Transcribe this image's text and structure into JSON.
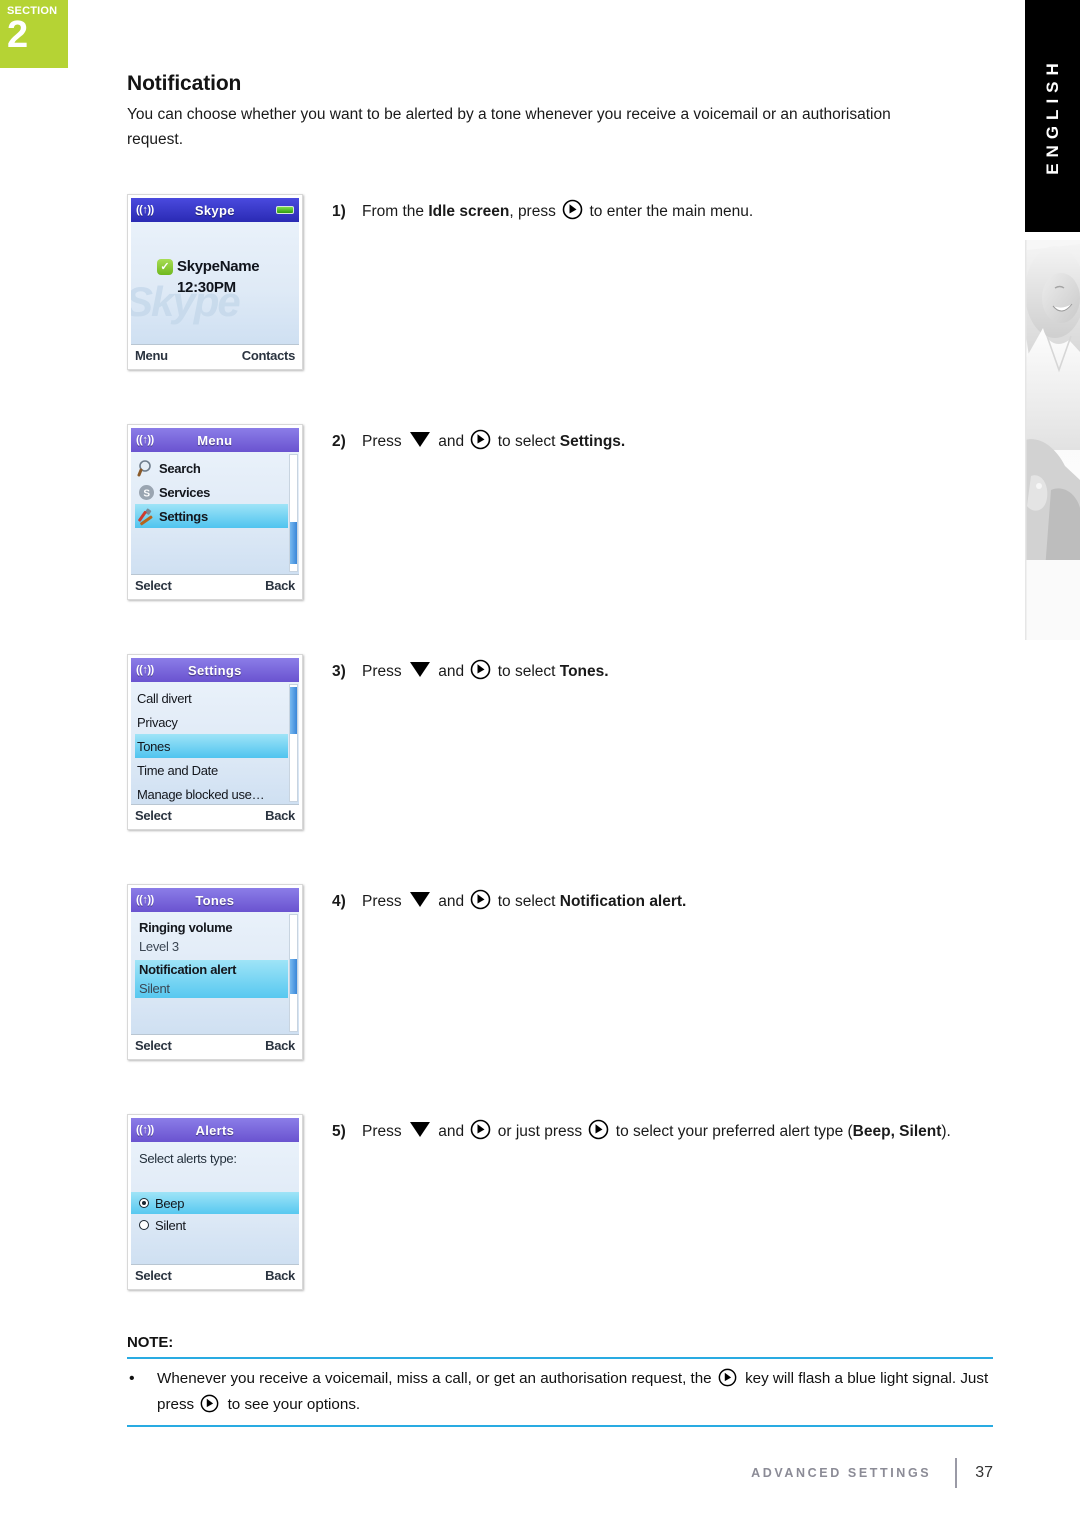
{
  "section_tab": {
    "label": "SECTION",
    "number": "2"
  },
  "language_tab": {
    "label": "ENGLISH"
  },
  "page": {
    "title": "Notification",
    "intro": "You can choose whether you want to be alerted by a tone whenever you receive a voicemail or an authorisation request."
  },
  "steps": [
    {
      "number": "1)",
      "text_parts": {
        "a": "From the ",
        "b": "Idle screen",
        "c": ", press ",
        "d": " to enter the main menu."
      },
      "screen": {
        "type": "idle",
        "title": "Skype",
        "signal_icon": "signal-icon",
        "battery_icon": "battery-icon",
        "status_icon": "online-check-icon",
        "username": "SkypeName",
        "time": "12:30PM",
        "watermark": "Skype",
        "softkey_left": "Menu",
        "softkey_right": "Contacts"
      }
    },
    {
      "number": "2)",
      "text_parts": {
        "a": "Press ",
        "b": " and ",
        "c": " to select ",
        "d": "Settings."
      },
      "screen": {
        "type": "list",
        "title": "Menu",
        "items": [
          {
            "label": "Search",
            "icon": "magnifier-icon",
            "selected": false
          },
          {
            "label": "Services",
            "icon": "skype-s-icon",
            "selected": false
          },
          {
            "label": "Settings",
            "icon": "tools-icon",
            "selected": true
          }
        ],
        "softkey_left": "Select",
        "softkey_right": "Back"
      }
    },
    {
      "number": "3)",
      "text_parts": {
        "a": "Press ",
        "b": " and ",
        "c": " to select ",
        "d": "Tones."
      },
      "screen": {
        "type": "list",
        "title": "Settings",
        "items": [
          {
            "label": "Call divert",
            "icon": "",
            "selected": false
          },
          {
            "label": "Privacy",
            "icon": "",
            "selected": false
          },
          {
            "label": "Tones",
            "icon": "",
            "selected": true
          },
          {
            "label": "Time and Date",
            "icon": "",
            "selected": false
          },
          {
            "label": "Manage blocked use…",
            "icon": "",
            "selected": false
          }
        ],
        "softkey_left": "Select",
        "softkey_right": "Back"
      }
    },
    {
      "number": "4)",
      "text_parts": {
        "a": "Press ",
        "b": " and ",
        "c": " to select ",
        "d": "Notification alert."
      },
      "screen": {
        "type": "pairs",
        "title": "Tones",
        "pairs": [
          {
            "name": "Ringing volume",
            "value": "Level 3",
            "selected": false
          },
          {
            "name": "Notification alert",
            "value": "Silent",
            "selected": true
          }
        ],
        "softkey_left": "Select",
        "softkey_right": "Back"
      }
    },
    {
      "number": "5)",
      "text_parts": {
        "a": "Press ",
        "b": " and ",
        "c": " or just press ",
        "d": " to select your preferred alert type (",
        "e": "Beep, Silent",
        "f": ")."
      },
      "screen": {
        "type": "alerts",
        "title": "Alerts",
        "prompt": "Select alerts type:",
        "options": [
          {
            "label": "Beep",
            "selected": true
          },
          {
            "label": "Silent",
            "selected": false
          }
        ],
        "softkey_left": "Select",
        "softkey_right": "Back"
      }
    }
  ],
  "note": {
    "title": "NOTE:",
    "bullet": "•",
    "text_a": "Whenever you receive a voicemail, miss a call, or get an authorisation request, the ",
    "text_b": " key will flash a blue light signal. Just press ",
    "text_c": " to see your options."
  },
  "footer": {
    "label": "ADVANCED SETTINGS",
    "page_number": "37"
  },
  "colors": {
    "section_green": "#b5d334",
    "note_rule_blue": "#29abe2",
    "highlight_cyan": "#4fc4ef"
  }
}
